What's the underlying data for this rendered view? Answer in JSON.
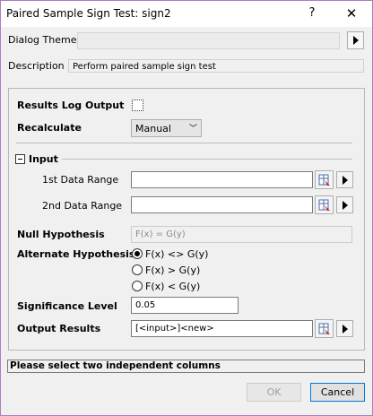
{
  "window": {
    "title": "Paired Sample Sign Test: sign2",
    "help_glyph": "?",
    "close_glyph": "✕"
  },
  "dialog_theme": {
    "label": "Dialog Theme",
    "value": ""
  },
  "description": {
    "label": "Description",
    "value": "Perform paired sample sign test"
  },
  "results_log": {
    "label": "Results Log Output",
    "checked": false
  },
  "recalculate": {
    "label": "Recalculate",
    "value": "Manual"
  },
  "input_section": {
    "label": "Input",
    "range1_label": "1st Data Range",
    "range1_value": "",
    "range2_label": "2nd Data Range",
    "range2_value": ""
  },
  "null_hypothesis": {
    "label": "Null Hypothesis",
    "value": "F(x) = G(y)"
  },
  "alternate_hypothesis": {
    "label": "Alternate Hypothesis",
    "options": [
      "F(x) <> G(y)",
      "F(x) > G(y)",
      "F(x) < G(y)"
    ],
    "selected_index": 0
  },
  "significance_level": {
    "label": "Significance Level",
    "value": "0.05"
  },
  "output_results": {
    "label": "Output Results",
    "value": "[<input>]<new>"
  },
  "status_message": "Please select two independent columns",
  "buttons": {
    "ok": "OK",
    "cancel": "Cancel"
  }
}
